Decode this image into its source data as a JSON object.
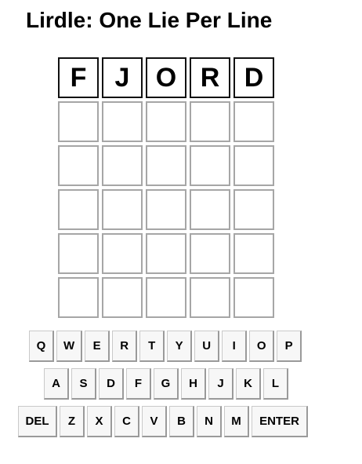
{
  "title": "Lirdle: One Lie Per Line",
  "board": {
    "rows": [
      [
        "F",
        "J",
        "O",
        "R",
        "D"
      ],
      [
        "",
        "",
        "",
        "",
        ""
      ],
      [
        "",
        "",
        "",
        "",
        ""
      ],
      [
        "",
        "",
        "",
        "",
        ""
      ],
      [
        "",
        "",
        "",
        "",
        ""
      ],
      [
        "",
        "",
        "",
        "",
        ""
      ]
    ]
  },
  "keyboard": {
    "row1": [
      "Q",
      "W",
      "E",
      "R",
      "T",
      "Y",
      "U",
      "I",
      "O",
      "P"
    ],
    "row2": [
      "A",
      "S",
      "D",
      "F",
      "G",
      "H",
      "J",
      "K",
      "L"
    ],
    "row3": [
      "DEL",
      "Z",
      "X",
      "C",
      "V",
      "B",
      "N",
      "M",
      "ENTER"
    ]
  }
}
